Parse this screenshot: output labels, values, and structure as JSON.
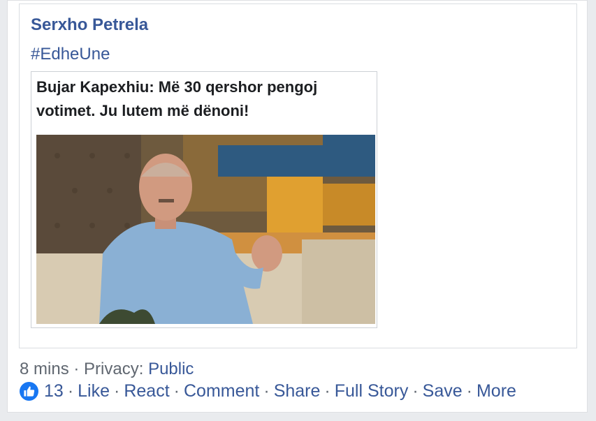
{
  "post": {
    "author": "Serxho Petrela",
    "hashtag": "#EdheUne",
    "headline": "Bujar Kapexhiu: Më 30 qershor pengoj votimet. Ju lutem më dënoni!"
  },
  "meta": {
    "time": "8 mins",
    "privacy_label": "Privacy:",
    "privacy_value": "Public"
  },
  "actions": {
    "like_count": "13",
    "like": "Like",
    "react": "React",
    "comment": "Comment",
    "share": "Share",
    "full_story": "Full Story",
    "save": "Save",
    "more": "More",
    "separator": "·"
  },
  "colors": {
    "link": "#385898",
    "like_badge": "#1877f2",
    "muted_text": "#606770"
  },
  "icons": {
    "like_badge": "thumbs-up-icon"
  }
}
